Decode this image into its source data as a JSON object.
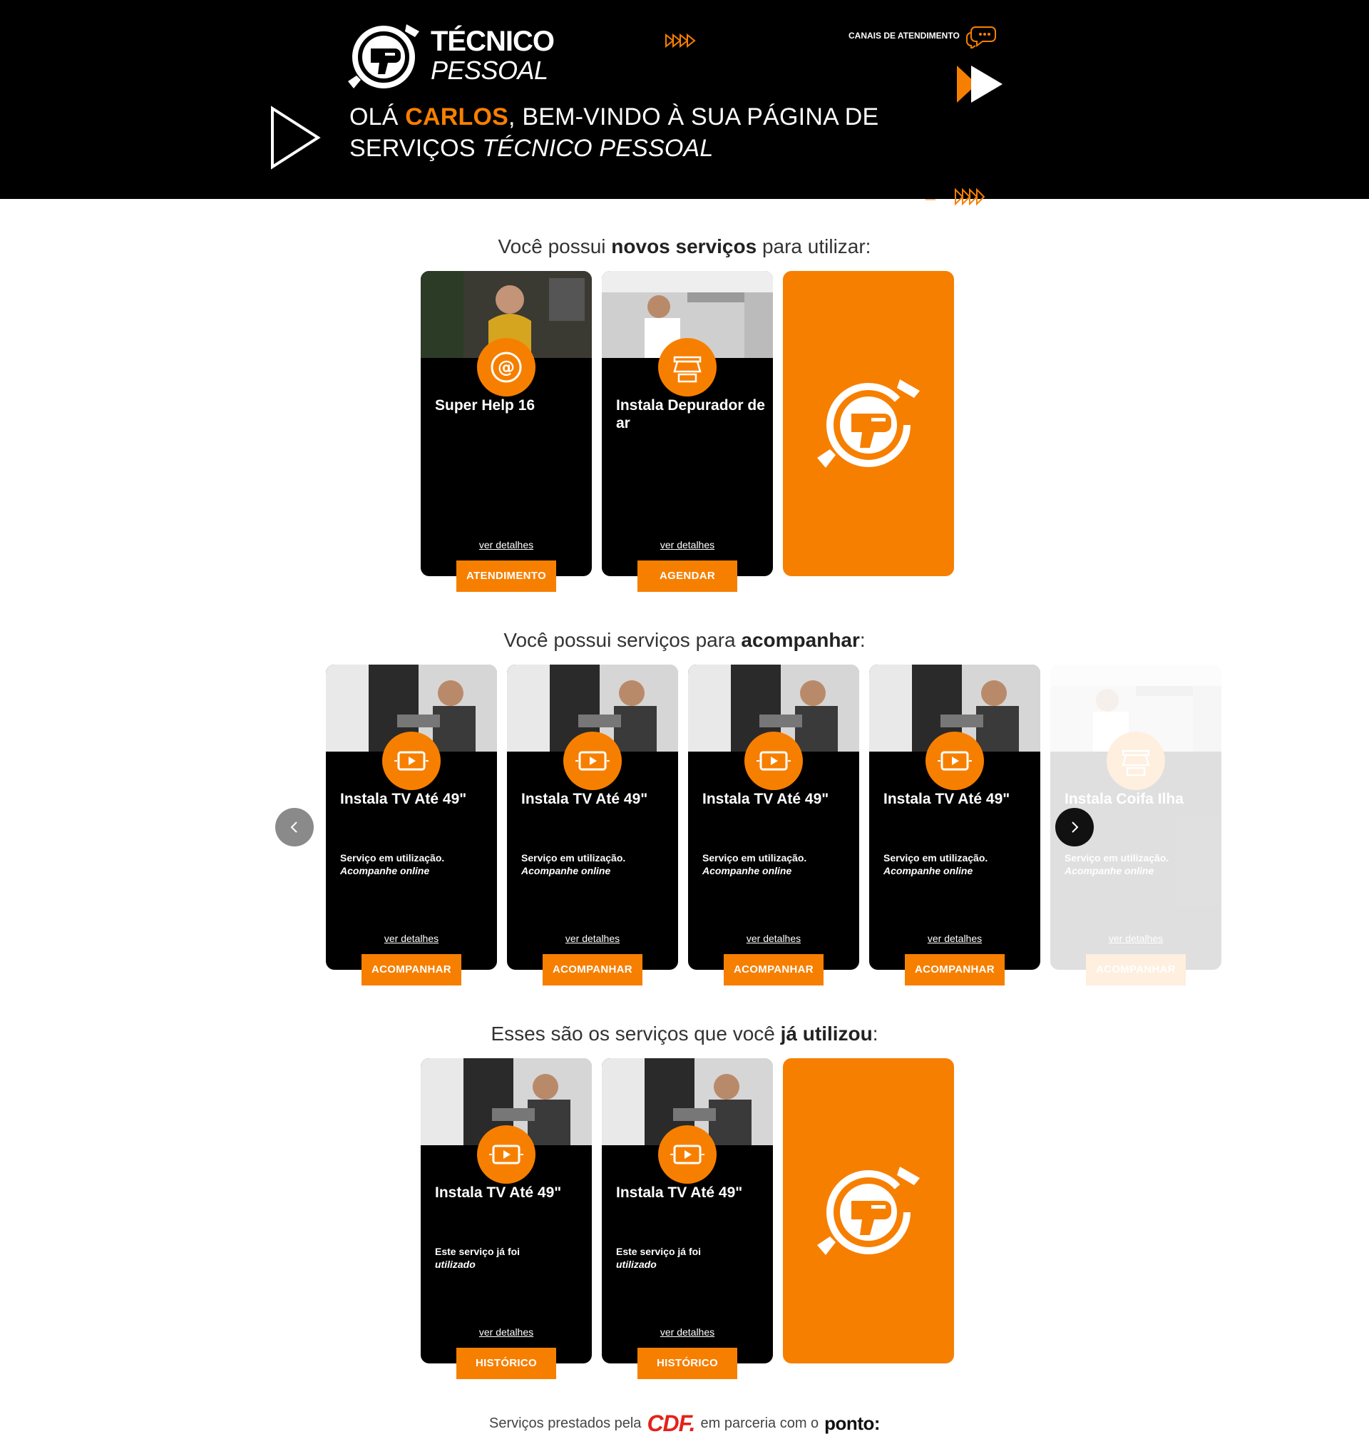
{
  "header": {
    "logo_line1": "TÉCNICO",
    "logo_line2": "PESSOAL",
    "channels_label": "CANAIS DE ATENDIMENTO",
    "welcome_prefix": "OLÁ ",
    "welcome_name": "CARLOS",
    "welcome_middle": ", BEM-VINDO À SUA PÁGINA DE SERVIÇOS ",
    "welcome_brand": "TÉCNICO PESSOAL"
  },
  "colors": {
    "accent": "#f77f00",
    "background_dark": "#000000",
    "cdf_red": "#e2231a"
  },
  "new_services": {
    "title_pre": "Você possui ",
    "title_bold": "novos serviços",
    "title_post": " para utilizar:",
    "cards": [
      {
        "title": "Super Help 16",
        "icon": "at-sign-icon",
        "details": "ver detalhes",
        "button": "ATENDIMENTO"
      },
      {
        "title": "Instala Depurador de ar",
        "icon": "range-hood-icon",
        "details": "ver detalhes",
        "button": "AGENDAR"
      }
    ]
  },
  "follow_services": {
    "title_pre": "Você possui serviços para ",
    "title_bold": "acompanhar",
    "title_post": ":",
    "cards": [
      {
        "title": "Instala TV Até 49\"",
        "icon": "tv-icon",
        "status": "Serviço em utilização.",
        "status_em": "Acompanhe online",
        "details": "ver detalhes",
        "button": "ACOMPANHAR"
      },
      {
        "title": "Instala TV Até 49\"",
        "icon": "tv-icon",
        "status": "Serviço em utilização.",
        "status_em": "Acompanhe online",
        "details": "ver detalhes",
        "button": "ACOMPANHAR"
      },
      {
        "title": "Instala TV Até 49\"",
        "icon": "tv-icon",
        "status": "Serviço em utilização.",
        "status_em": "Acompanhe online",
        "details": "ver detalhes",
        "button": "ACOMPANHAR"
      },
      {
        "title": "Instala TV Até 49\"",
        "icon": "tv-icon",
        "status": "Serviço em utilização.",
        "status_em": "Acompanhe online",
        "details": "ver detalhes",
        "button": "ACOMPANHAR"
      },
      {
        "title": "Instala Coifa Ilha",
        "icon": "range-hood-icon",
        "status": "Serviço em utilização.",
        "status_em": "Acompanhe online",
        "details": "ver detalhes",
        "button": "ACOMPANHAR"
      }
    ]
  },
  "used_services": {
    "title_pre": "Esses são os serviços que você ",
    "title_bold": "já utilizou",
    "title_post": ":",
    "cards": [
      {
        "title": "Instala TV Até 49\"",
        "icon": "tv-icon",
        "status": "Este serviço já foi",
        "status_em": "utilizado",
        "details": "ver detalhes",
        "button": "HISTÓRICO"
      },
      {
        "title": "Instala TV Até 49\"",
        "icon": "tv-icon",
        "status": "Este serviço já foi",
        "status_em": "utilizado",
        "details": "ver detalhes",
        "button": "HISTÓRICO"
      }
    ]
  },
  "footer": {
    "text_pre": "Serviços prestados pela",
    "cdf": "CDF.",
    "text_mid": "em parceria com o",
    "ponto": "ponto:"
  }
}
